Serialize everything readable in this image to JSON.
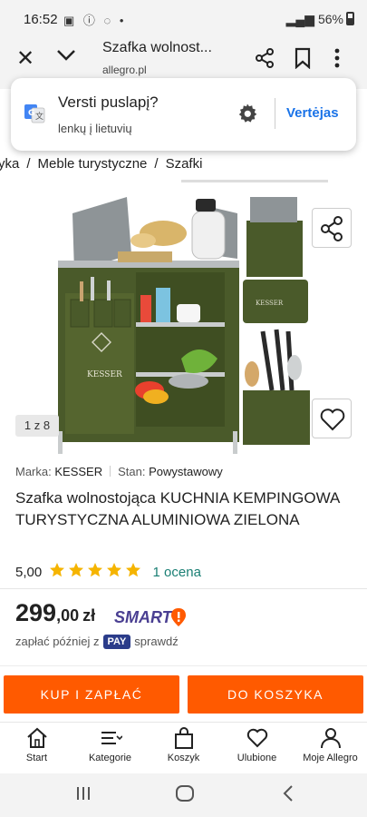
{
  "status_bar": {
    "time": "16:52",
    "battery": "56%"
  },
  "browser": {
    "page_title": "Szafka wolnost...",
    "url": "allegro.pl"
  },
  "translate": {
    "title": "Versti puslapį?",
    "languages": "lenkų į lietuvių",
    "button": "Vertėjas"
  },
  "breadcrumb": [
    "yka",
    "Meble turystyczne",
    "Szafki"
  ],
  "gallery": {
    "counter": "1 z 8",
    "brand_on_image": "KESSER"
  },
  "product": {
    "brand_label": "Marka:",
    "brand": "KESSER",
    "condition_label": "Stan:",
    "condition": "Powystawowy",
    "title": "Szafka wolnostojąca KUCHNIA KEMPINGOWA TURYSTYCZNA ALUMINIOWA ZIELONA",
    "rating_value": "5,00",
    "stars": 5,
    "rating_count": "1 ocena",
    "price_main": "299",
    "price_decimal": ",00",
    "currency": "zł",
    "smart_label": "SMART",
    "pay_later_prefix": "zapłać później z",
    "pay_badge": "PAY",
    "pay_later_suffix": "sprawdź"
  },
  "actions": {
    "buy": "KUP I ZAPŁAĆ",
    "cart": "DO KOSZYKA"
  },
  "bottom_nav": [
    {
      "label": "Start",
      "icon": "home-icon"
    },
    {
      "label": "Kategorie",
      "icon": "menu-icon"
    },
    {
      "label": "Koszyk",
      "icon": "bag-icon"
    },
    {
      "label": "Ulubione",
      "icon": "heart-icon"
    },
    {
      "label": "Moje Allegro",
      "icon": "user-icon"
    }
  ],
  "colors": {
    "accent": "#ff5a00",
    "link": "#1a73e8",
    "rating_link": "#1a7f74",
    "smart": "#4a3f92",
    "star": "#f5b400",
    "product_green": "#4a5a2a"
  }
}
